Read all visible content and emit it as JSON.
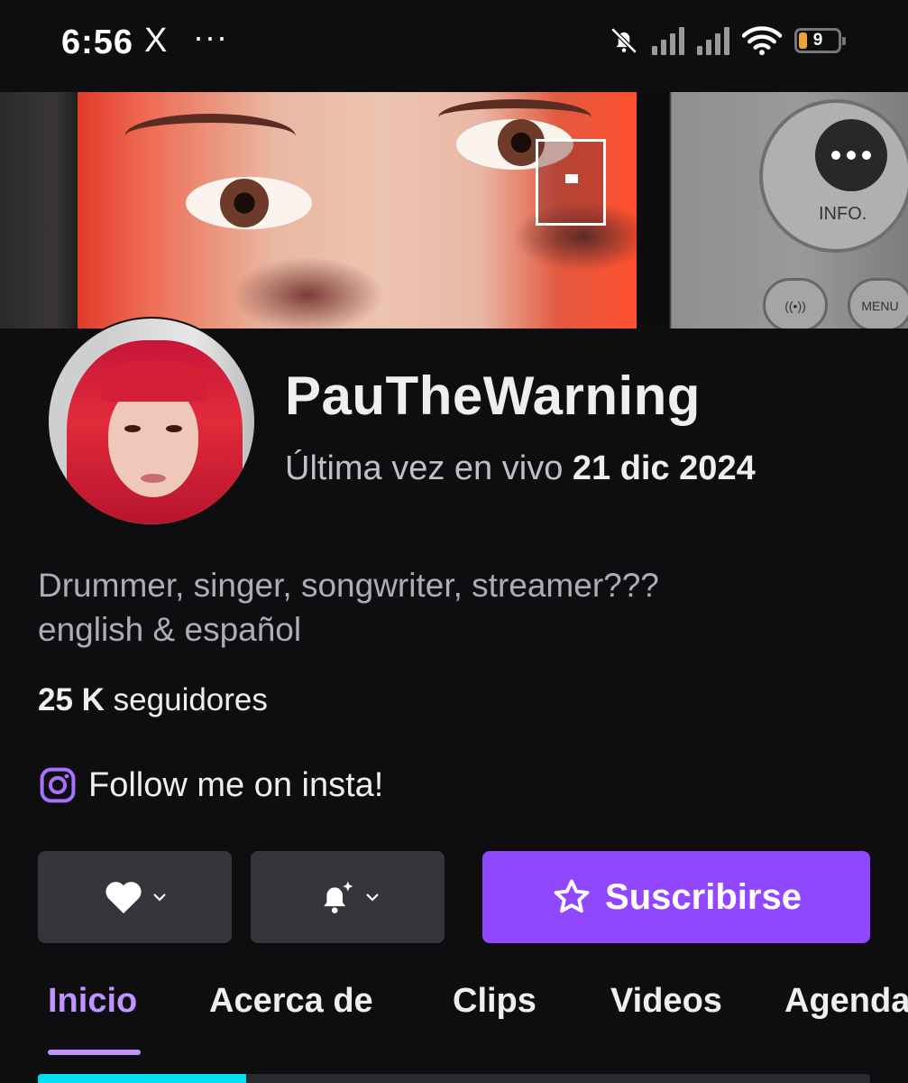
{
  "status_bar": {
    "time": "6:56",
    "x_icon": "X",
    "dots": "···",
    "battery_level": "9"
  },
  "banner": {
    "camera_dial_label": "INFO.",
    "camera_button_left": "((•))",
    "camera_button_right": "MENU",
    "more_icon": "more-horizontal-icon"
  },
  "profile": {
    "channel_name": "PauTheWarning",
    "last_live_prefix": "Última vez en vivo",
    "last_live_date": "21 dic 2024",
    "bio_line1": "Drummer, singer, songwriter, streamer???",
    "bio_line2": "english & español",
    "followers_count": "25 K",
    "followers_label": "seguidores",
    "social_link_text": "Follow me on insta!",
    "social_icon": "instagram-icon"
  },
  "actions": {
    "follow_icon": "heart-icon",
    "notify_icon": "bell-sparkle-icon",
    "subscribe_label": "Suscribirse",
    "subscribe_icon": "star-outline-icon"
  },
  "tabs": [
    {
      "label": "Inicio",
      "active": true
    },
    {
      "label": "Acerca de",
      "active": false
    },
    {
      "label": "Clips",
      "active": false
    },
    {
      "label": "Videos",
      "active": false
    },
    {
      "label": "Agenda",
      "active": false
    }
  ],
  "progress": {
    "fraction": 0.25
  },
  "colors": {
    "background": "#0e0e10",
    "accent": "#9147ff",
    "accent_light": "#bf94ff",
    "button_gray": "#35353b",
    "progress": "#00e1f0"
  }
}
